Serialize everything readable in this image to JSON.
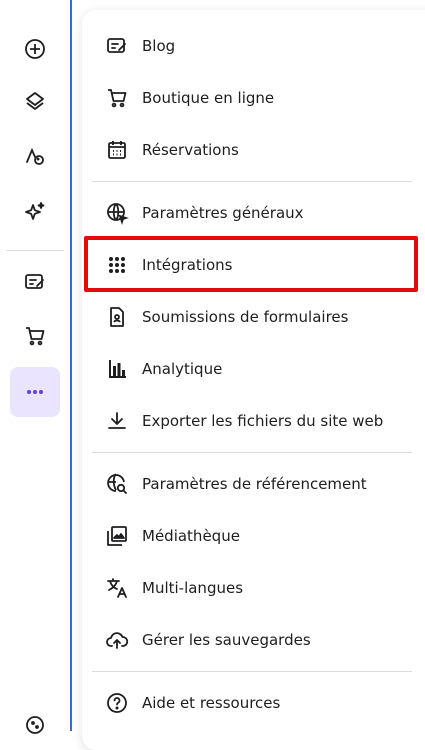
{
  "rail": {
    "icons": [
      "add-circle-icon",
      "layers-icon",
      "palette-icon",
      "sparkle-icon",
      "blog-edit-icon",
      "cart-icon",
      "more-dots-icon",
      "cookie-icon"
    ]
  },
  "menu": {
    "items": [
      {
        "label": "Blog",
        "icon": "blog-edit-icon"
      },
      {
        "label": "Boutique en ligne",
        "icon": "cart-icon"
      },
      {
        "label": "Réservations",
        "icon": "calendar-icon"
      },
      {
        "label": "Paramètres généraux",
        "icon": "globe-cursor-icon"
      },
      {
        "label": "Intégrations",
        "icon": "grid-dots-icon"
      },
      {
        "label": "Soumissions de formulaires",
        "icon": "form-file-icon"
      },
      {
        "label": "Analytique",
        "icon": "bar-chart-icon"
      },
      {
        "label": "Exporter les fichiers du site web",
        "icon": "download-icon"
      },
      {
        "label": "Paramètres de référencement",
        "icon": "seo-globe-search-icon"
      },
      {
        "label": "Médiathèque",
        "icon": "media-library-icon"
      },
      {
        "label": "Multi-langues",
        "icon": "translate-icon"
      },
      {
        "label": "Gérer les sauvegardes",
        "icon": "cloud-upload-icon"
      },
      {
        "label": "Aide et ressources",
        "icon": "help-circle-icon"
      }
    ]
  },
  "colors": {
    "accent": "#673de6",
    "active_bg": "#ebe4ff",
    "highlight": "#e30b0b",
    "rail_border": "#2f6fd1"
  }
}
